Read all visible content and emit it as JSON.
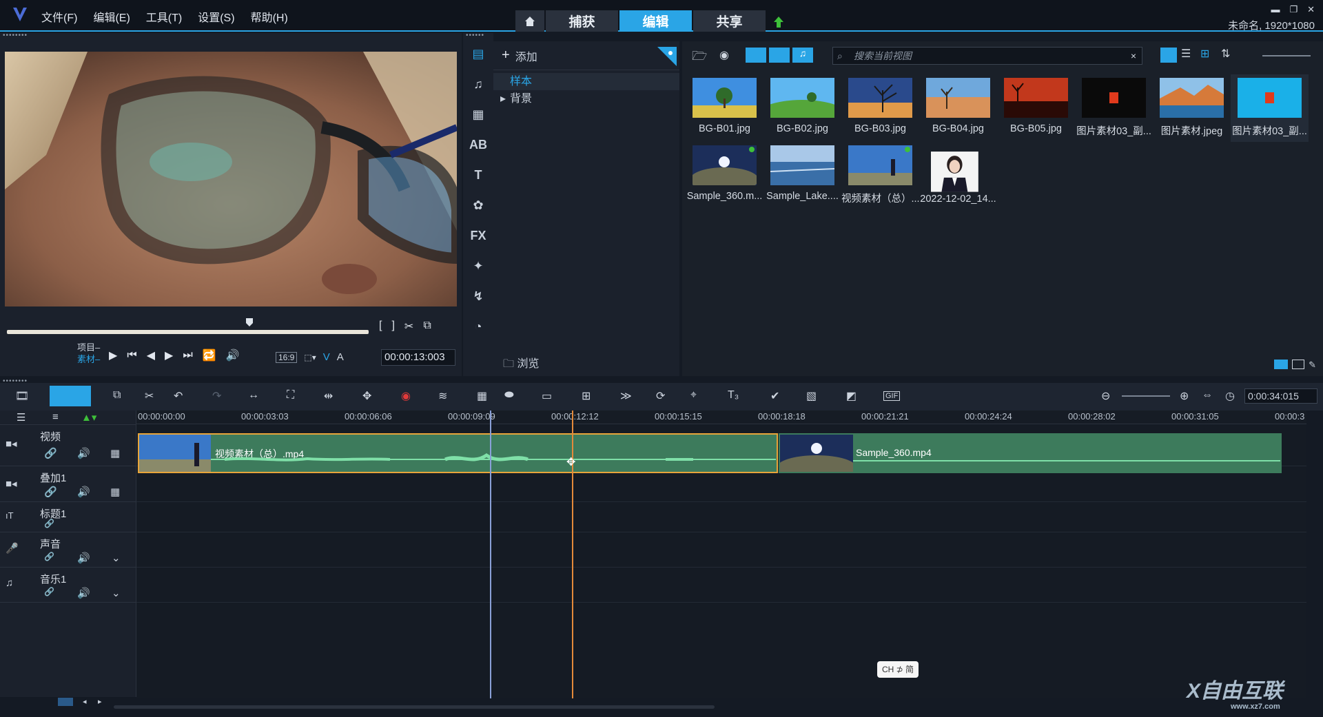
{
  "app": {
    "project_info": "未命名, 1920*1080"
  },
  "menu": [
    "文件(F)",
    "编辑(E)",
    "工具(T)",
    "设置(S)",
    "帮助(H)"
  ],
  "modes": {
    "capture": "捕获",
    "edit": "编辑",
    "share": "共享"
  },
  "player": {
    "project_label": "项目–",
    "clip_label": "素材–",
    "timecode": "00:00:13:003",
    "aspect": "16:9",
    "v_label": "V",
    "a_label": "A"
  },
  "library": {
    "add_label": "添加",
    "tree": [
      "样本",
      "背景"
    ],
    "browse_label": "浏览",
    "search_placeholder": "搜索当前视图",
    "items": [
      {
        "label": "BG-B01.jpg"
      },
      {
        "label": "BG-B02.jpg"
      },
      {
        "label": "BG-B03.jpg"
      },
      {
        "label": "BG-B04.jpg"
      },
      {
        "label": "BG-B05.jpg"
      },
      {
        "label": "图片素材03_副..."
      },
      {
        "label": "图片素材.jpeg"
      },
      {
        "label": "图片素材03_副..."
      },
      {
        "label": "Sample_360.m..."
      },
      {
        "label": "Sample_Lake...."
      },
      {
        "label": "视频素材（总）..."
      },
      {
        "label": "2022-12-02_14..."
      }
    ]
  },
  "timeline": {
    "duration": "0:00:34:015",
    "ruler": [
      "00:00:00:00",
      "00:00:03:03",
      "00:00:06:06",
      "00:00:09:09",
      "00:00:12:12",
      "00:00:15:15",
      "00:00:18:18",
      "00:00:21:21",
      "00:00:24:24",
      "00:00:28:02",
      "00:00:31:05",
      "00:00:3"
    ],
    "tracks": [
      "视频",
      "叠加1",
      "标题1",
      "声音",
      "音乐1"
    ],
    "clips": [
      {
        "name": "视频素材（总）.mp4"
      },
      {
        "name": "Sample_360.mp4"
      }
    ]
  },
  "ime": "CH ⊅ 简",
  "watermark": {
    "brand": "X自由互联",
    "url": "www.xz7.com"
  },
  "colors": {
    "accent": "#2aa5e6",
    "clip": "#3d7b5c",
    "playhead": "#e58a3a",
    "selection_line": "#8aa0d8"
  }
}
